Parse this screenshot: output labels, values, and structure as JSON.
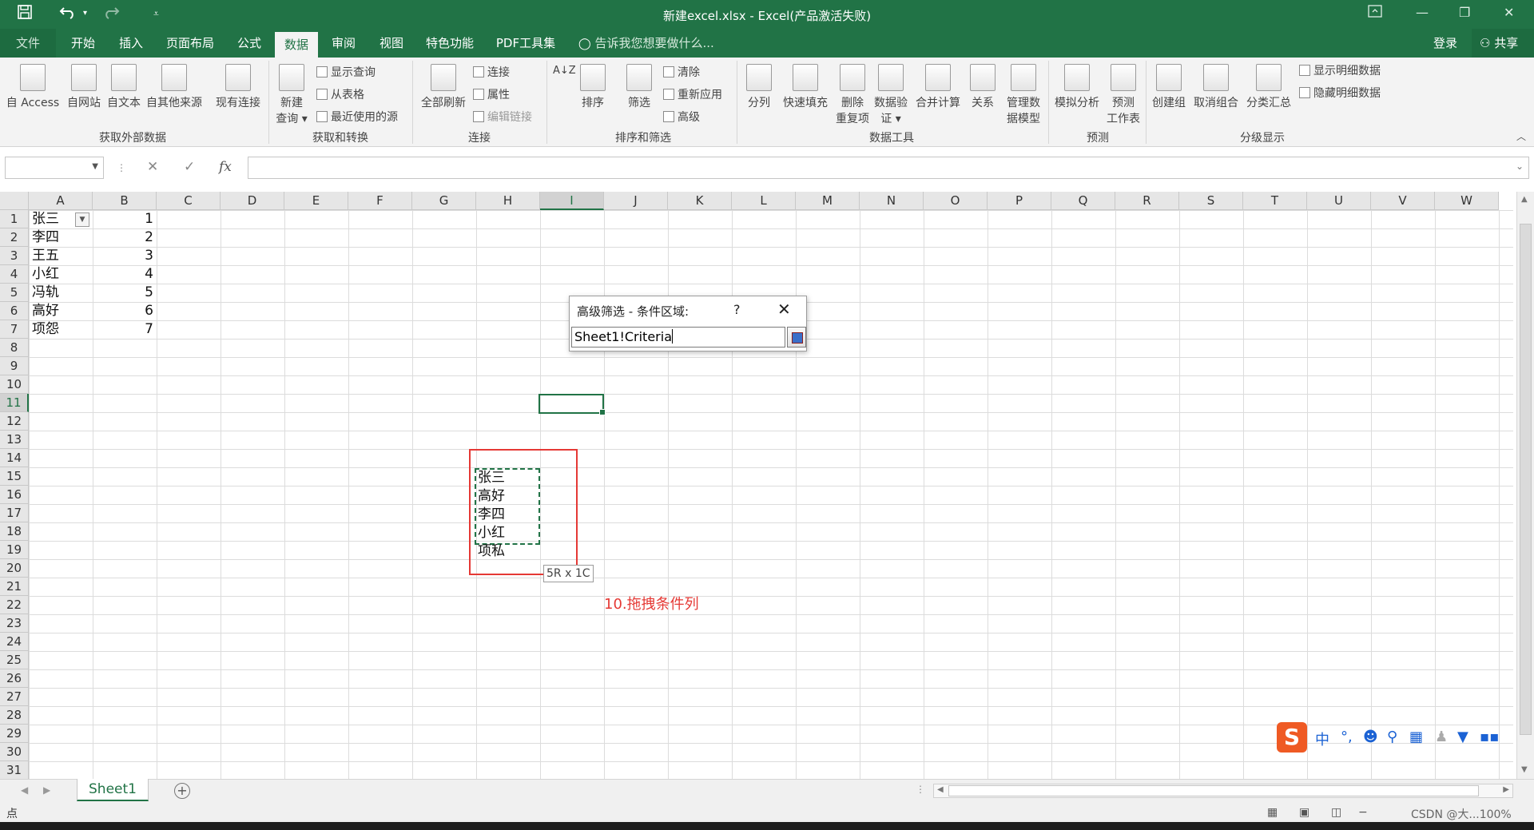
{
  "titlebar": {
    "title": "新建excel.xlsx - Excel(产品激活失败)",
    "save_icon": "save-icon",
    "undo_icon": "undo-icon",
    "redo_icon": "redo-icon",
    "customize_icon": "customize-qat-icon",
    "ribbon_display_icon": "ribbon-display-options-icon",
    "minimize": "—",
    "restore": "❐",
    "close": "✕"
  },
  "menu": {
    "tabs": [
      "文件",
      "开始",
      "插入",
      "页面布局",
      "公式",
      "数据",
      "审阅",
      "视图",
      "特色功能",
      "PDF工具集"
    ],
    "active_tab": "数据",
    "tell_me": "告诉我您想要做什么...",
    "login": "登录",
    "share": "共享"
  },
  "ribbon": {
    "get_external": {
      "buttons": [
        "自 Access",
        "自网站",
        "自文本",
        "自其他来源",
        "现有连接"
      ],
      "group": "获取外部数据"
    },
    "get_transform": {
      "new_query": "新建",
      "new_query_2": "查询 ▾",
      "show_query": "显示查询",
      "from_table": "从表格",
      "recent_sources": "最近使用的源",
      "group": "获取和转换"
    },
    "connections": {
      "refresh_all": "全部刷新",
      "connections": "连接",
      "properties": "属性",
      "edit_links": "编辑链接",
      "group": "连接"
    },
    "sort_filter": {
      "sort": "排序",
      "filter": "筛选",
      "clear": "清除",
      "reapply": "重新应用",
      "advanced": "高级",
      "group": "排序和筛选"
    },
    "data_tools": {
      "buttons": [
        "分列",
        "快速填充",
        "删除",
        "数据验",
        "合并计算",
        "关系",
        "管理数"
      ],
      "buttons_line2": [
        "",
        "",
        "重复项",
        "证 ▾",
        "",
        "",
        "据模型"
      ],
      "group": "数据工具"
    },
    "forecast": {
      "whatif": "模拟分析",
      "forecast_sheet": "预测",
      "forecast_sheet_2": "工作表",
      "group": "预测"
    },
    "outline": {
      "group_btn": "创建组",
      "ungroup": "取消组合",
      "subtotal": "分类汇总",
      "show_detail": "显示明细数据",
      "hide_detail": "隐藏明细数据",
      "group": "分级显示"
    }
  },
  "formula_bar": {
    "name_box": "",
    "cancel": "✕",
    "enter": "✓",
    "fx": "fx",
    "value": ""
  },
  "sheet": {
    "columns": [
      "A",
      "B",
      "C",
      "D",
      "E",
      "F",
      "G",
      "H",
      "I",
      "J",
      "K",
      "L",
      "M",
      "N",
      "O",
      "P",
      "Q",
      "R",
      "S",
      "T",
      "U",
      "V",
      "W"
    ],
    "selected_column": "I",
    "rows": [
      "1",
      "2",
      "3",
      "4",
      "5",
      "6",
      "7",
      "8",
      "9",
      "10",
      "11",
      "12",
      "13",
      "14",
      "15",
      "16",
      "17",
      "18",
      "19",
      "20",
      "21",
      "22",
      "23",
      "24",
      "25",
      "26",
      "27",
      "28",
      "29",
      "30",
      "31"
    ],
    "selected_row": "11",
    "col_a": [
      "张三",
      "李四",
      "王五",
      "小红",
      "冯轨",
      "高好",
      "项怨"
    ],
    "col_b": [
      "1",
      "2",
      "3",
      "4",
      "5",
      "6",
      "7"
    ],
    "criteria_list": [
      "张三",
      "高好",
      "李四",
      "小红",
      "项私"
    ],
    "drag_tooltip": "5R x 1C",
    "annotation": "10.拖拽条件列"
  },
  "dialog": {
    "title": "高级筛选 - 条件区域:",
    "help": "?",
    "close": "✕",
    "value": "Sheet1!Criteria"
  },
  "ime": {
    "lang": "中",
    "punct": "°,",
    "icons": [
      "emoji-icon",
      "mic-icon",
      "keyboard-icon",
      "user-icon",
      "skin-icon",
      "apps-icon"
    ]
  },
  "sheet_tabs": {
    "active": "Sheet1",
    "add": "+"
  },
  "status": {
    "mode": "点",
    "watermark": "CSDN @大...100%"
  },
  "colors": {
    "excel_green": "#217346",
    "annotation_red": "#e53935"
  }
}
